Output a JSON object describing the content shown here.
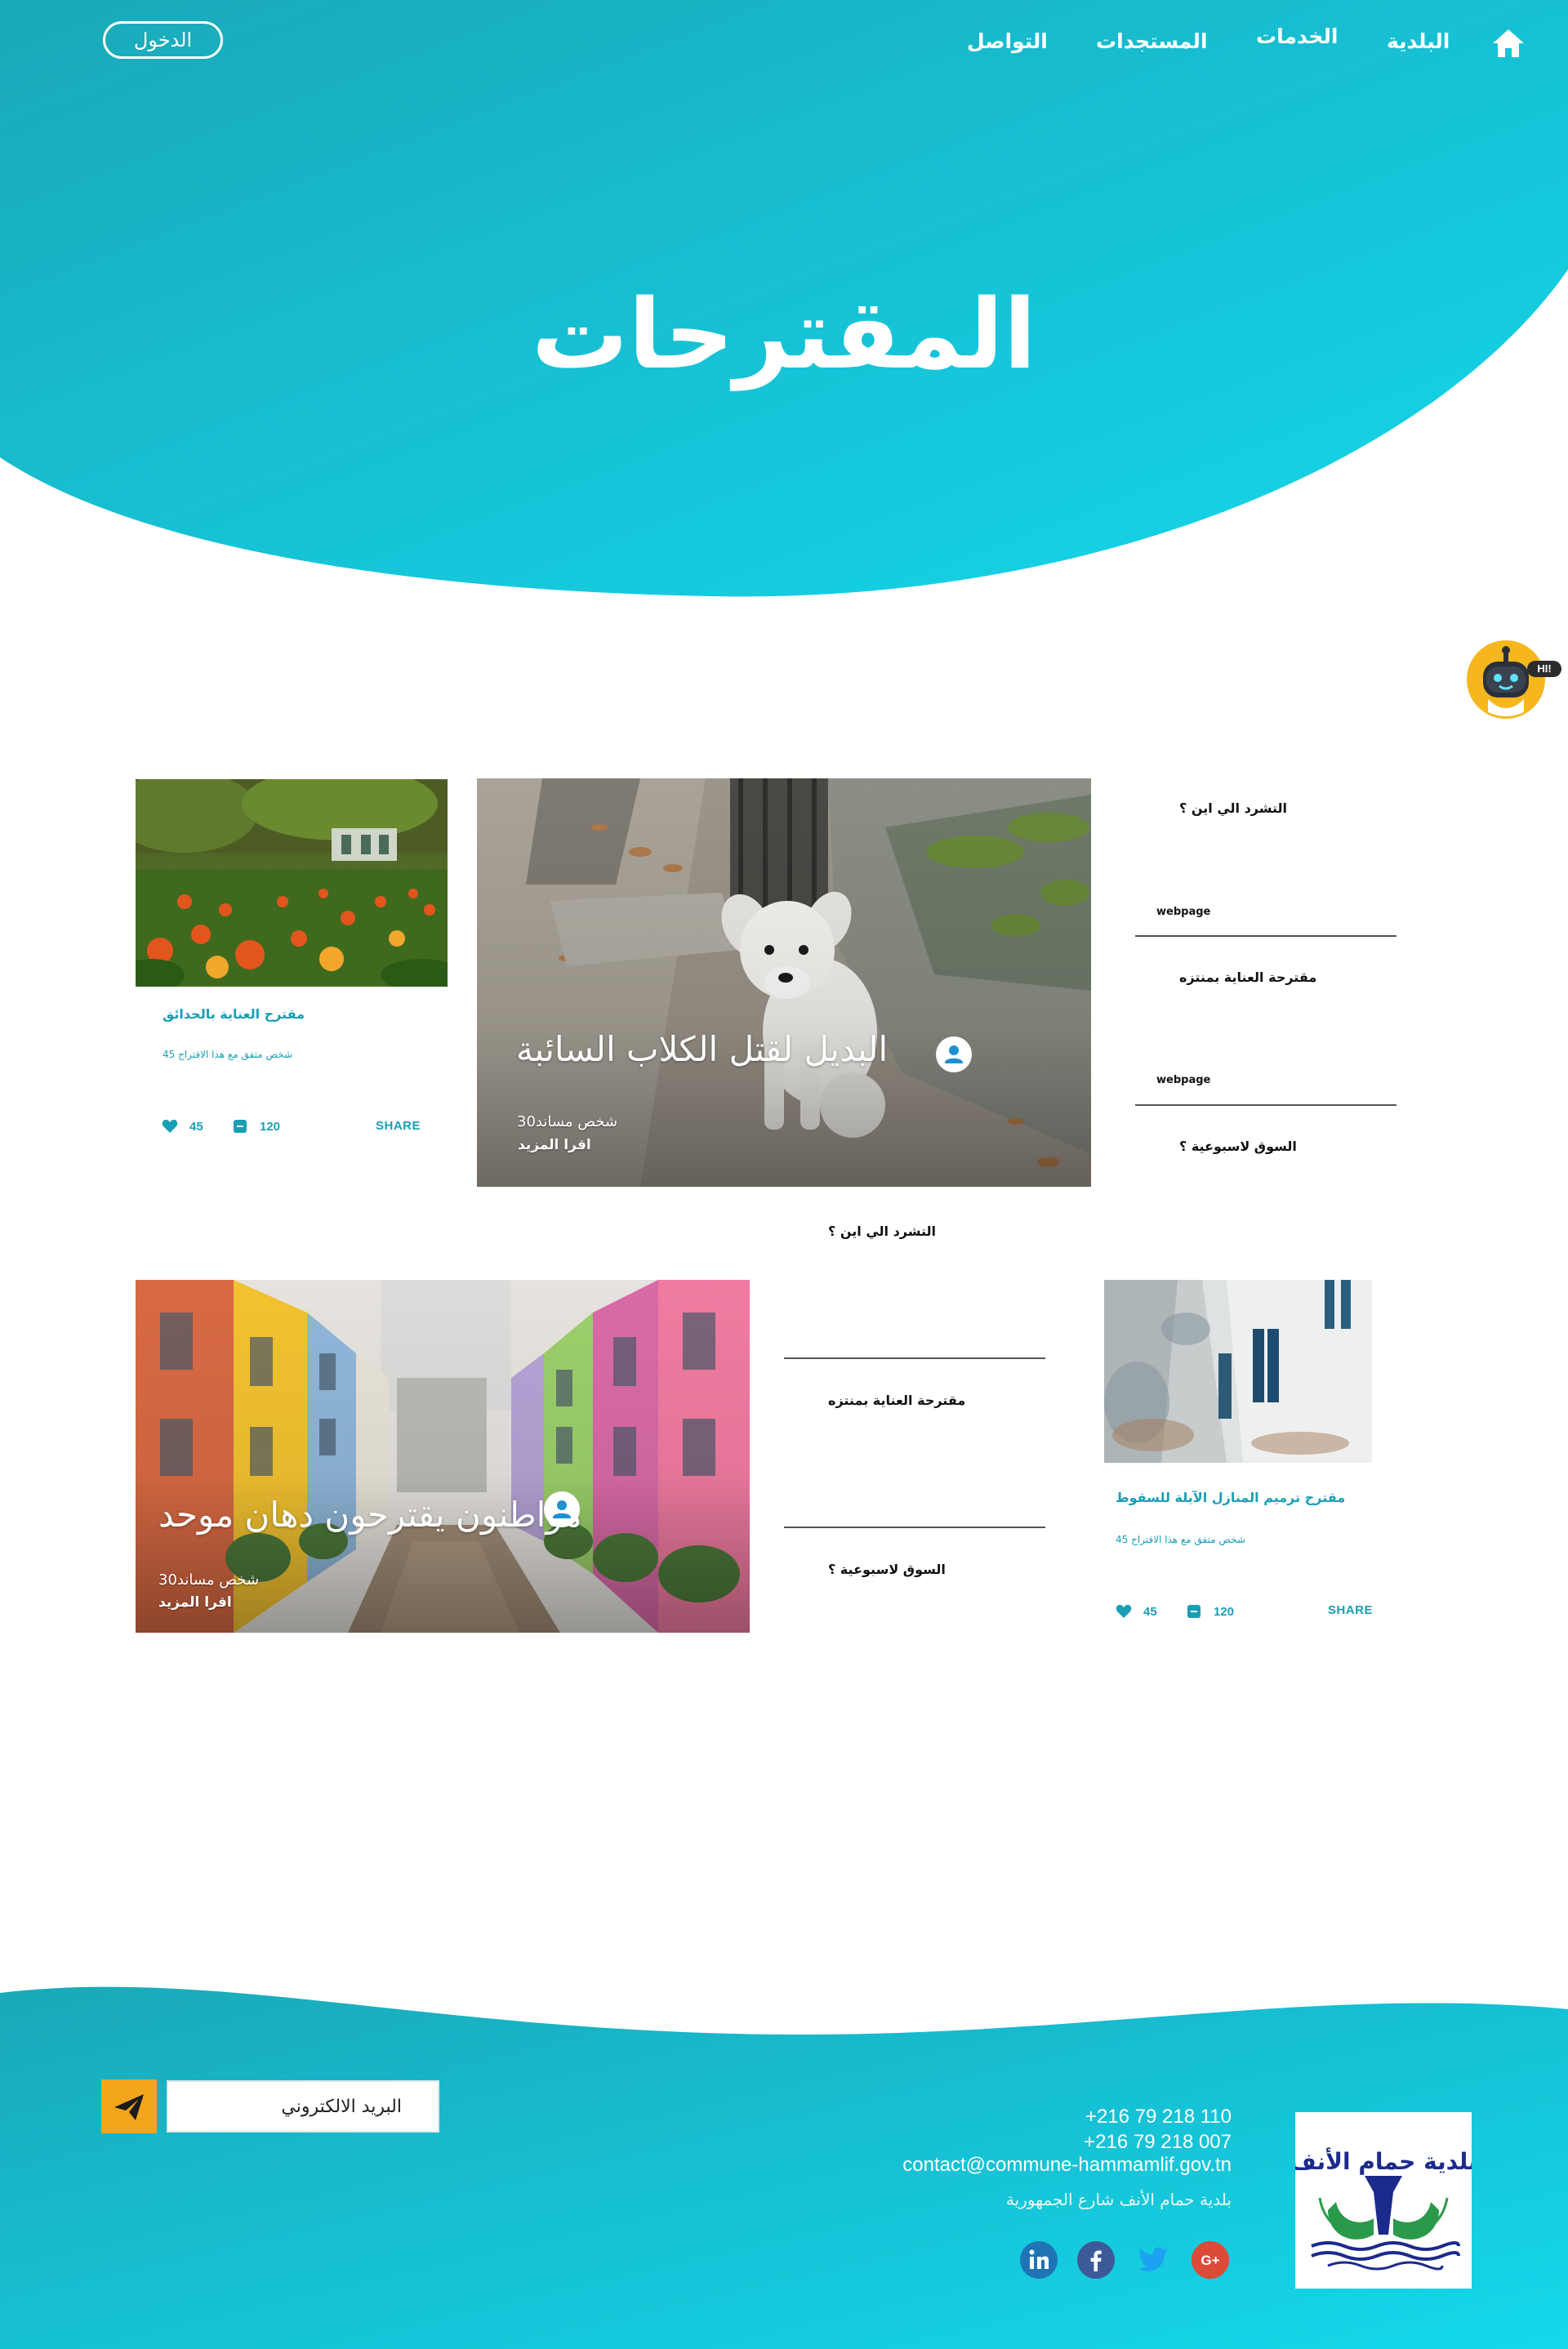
{
  "nav": {
    "login_label": "الدخول",
    "items": [
      {
        "label": "البلدية"
      },
      {
        "label": "الخدمات"
      },
      {
        "label": "المستجدات"
      },
      {
        "label": "التواصل"
      }
    ]
  },
  "hero": {
    "title": "المقترحات"
  },
  "chatbot": {
    "badge": "HI!"
  },
  "cards": {
    "gardens": {
      "title": "مقترح العناية بالحدائق",
      "subtitle": "45 شخص متفق مع هذا الاقتراح",
      "likes": "45",
      "comments": "120",
      "share": "SHARE"
    },
    "dogs": {
      "title": "البديل لقتل الكلاب السائبة",
      "supporters": "30شخص مساند",
      "read_more": "اقرا المزيد"
    },
    "paint": {
      "title": "مواطنون يقترحون دهان موحد",
      "supporters": "30شخص مساند",
      "read_more": "اقرا المزيد"
    },
    "houses": {
      "title": "مقترح ترميم المنازل الآيلة للسقوط",
      "subtitle": "45 شخص متفق مع هذا الاقتراح",
      "likes": "45",
      "comments": "120",
      "share": "SHARE"
    }
  },
  "sidebar_top": {
    "links": [
      "التشرد الي اين ؟",
      "مقترحة العناية بمنتزه",
      "السوق لاسبوعية ؟"
    ],
    "webpage_label": "webpage"
  },
  "sidebar_middle": {
    "links": [
      "التشرد الي اين ؟",
      "مقترحة العناية بمنتزه",
      "السوق لاسبوعية ؟"
    ]
  },
  "footer": {
    "email_placeholder": "البريد الالكتروني",
    "phone1": "+216 79 218 110",
    "phone2": "+216 79 218 007",
    "email": "contact@commune-hammamlif.gov.tn",
    "address": "بلدية حمام الأنف شارع الجمهورية",
    "logo_text": "بلدية حمام الأنف",
    "social_icons": [
      "linkedin-icon",
      "facebook-icon",
      "twitter-icon",
      "google-plus-icon"
    ]
  },
  "colors": {
    "brand_teal_dark": "#1aa9b8",
    "brand_teal_light": "#15d4e6",
    "accent_orange": "#f3a51b",
    "link_teal": "#1a9fb5"
  }
}
